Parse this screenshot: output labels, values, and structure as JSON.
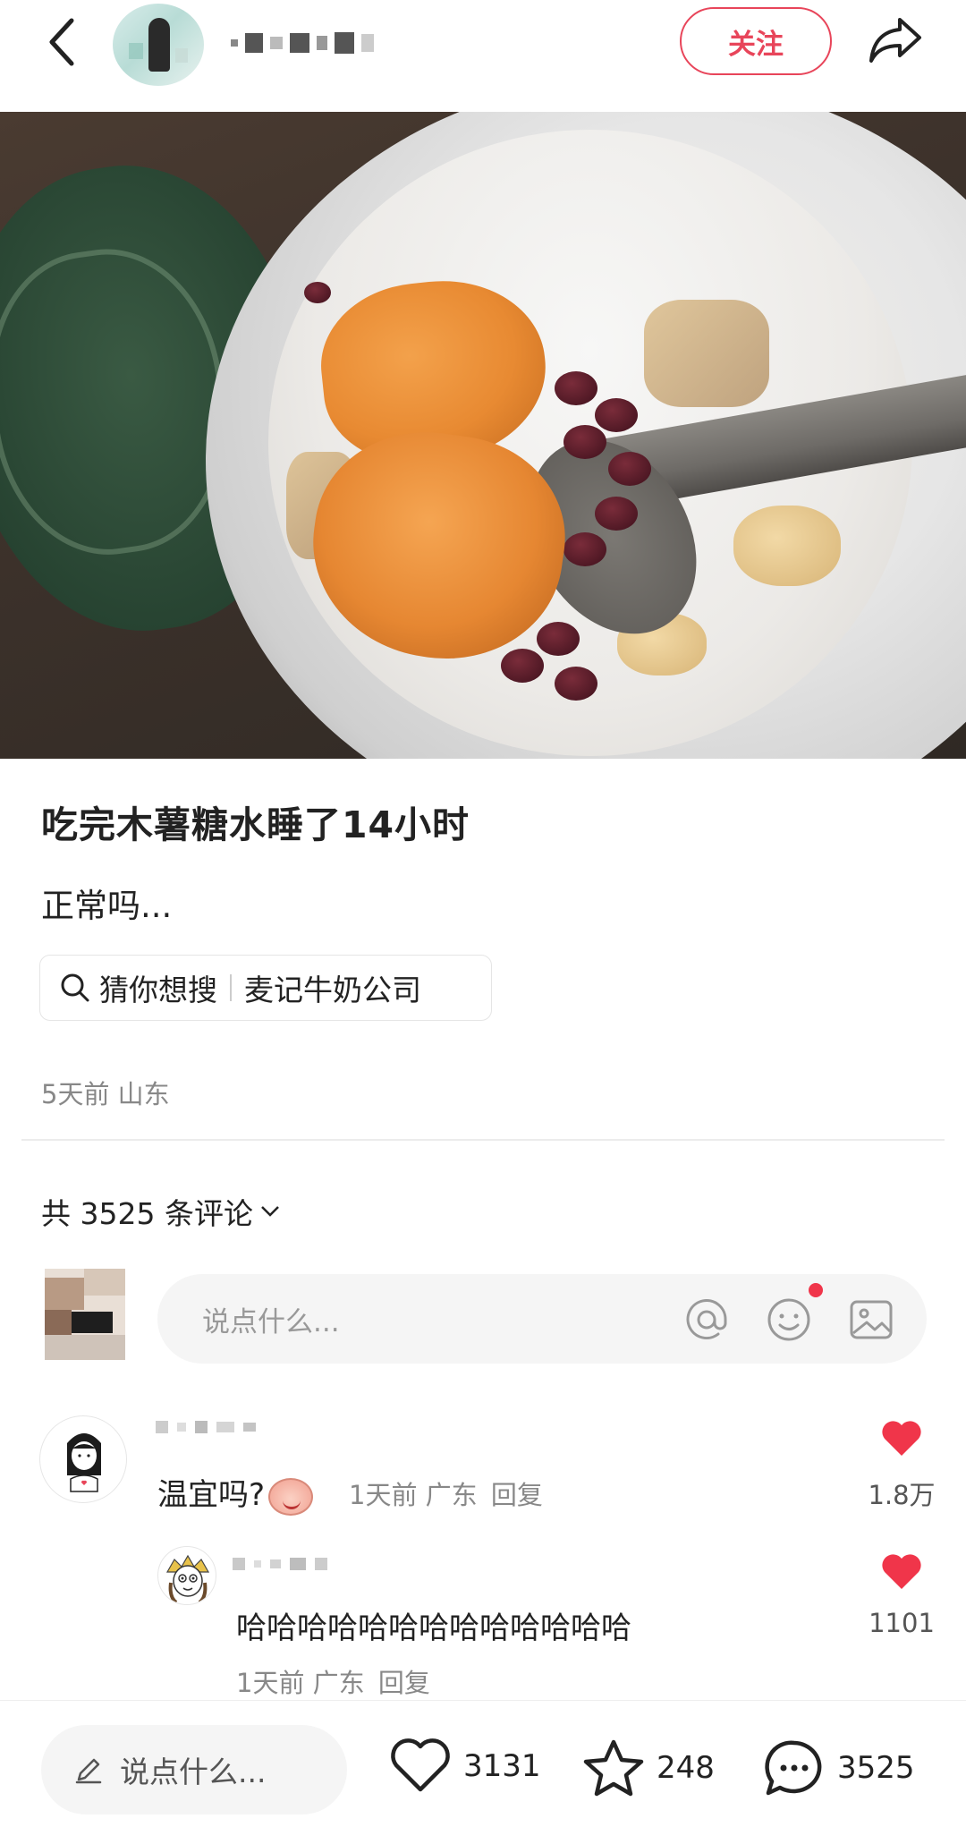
{
  "header": {
    "follow_label": "关注"
  },
  "post": {
    "title": "吃完木薯糖水睡了14小时",
    "body": "正常吗...",
    "search_chip": {
      "prefix": "猜你想搜",
      "query": "麦记牛奶公司"
    },
    "meta": "5天前 山东"
  },
  "comments_section": {
    "count_label": "共 3525 条评论",
    "input_placeholder": "说点什么..."
  },
  "comments": [
    {
      "text": "温宜吗?",
      "time": "1天前",
      "location": "广东",
      "reply_label": "回复",
      "likes": "1.8万"
    },
    {
      "text": "哈哈哈哈哈哈哈哈哈哈哈哈哈",
      "time": "1天前",
      "location": "广东",
      "reply_label": "回复",
      "likes": "1101"
    }
  ],
  "bottom_bar": {
    "input_placeholder": "说点什么...",
    "likes": "3131",
    "favorites": "248",
    "comments": "3525"
  },
  "colors": {
    "accent": "#e8455a",
    "like_red": "#f0354a"
  },
  "icons": [
    "back-icon",
    "share-icon",
    "search-icon",
    "chevron-down-icon",
    "at-icon",
    "emoji-icon",
    "image-icon",
    "heart-icon",
    "pencil-icon",
    "star-icon",
    "comment-icon"
  ]
}
